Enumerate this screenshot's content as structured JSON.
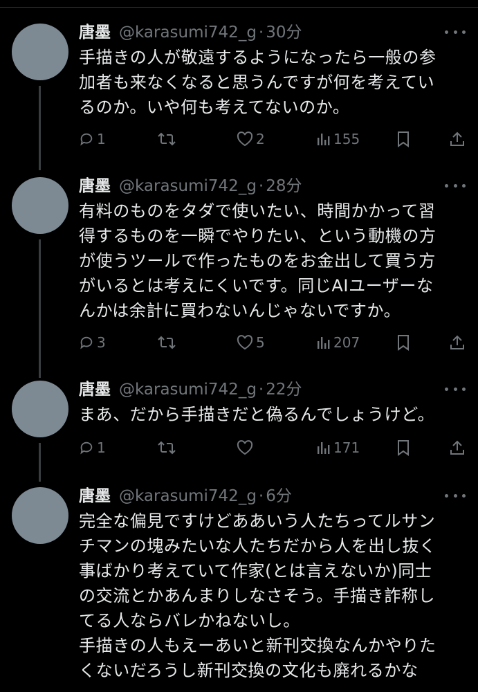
{
  "tweets": [
    {
      "name": "唐墨",
      "handle": "@karasumi742_g",
      "separator": "·",
      "time": "30分",
      "lines": [
        "手描きの人が敬遠するようになったら一般の参",
        "加者も来なくなると思うんですが何を考えてい",
        "るのか。いや何も考えてないのか。"
      ],
      "replies": "1",
      "retweets": "",
      "likes": "2",
      "views": "155"
    },
    {
      "name": "唐墨",
      "handle": "@karasumi742_g",
      "separator": "·",
      "time": "28分",
      "lines": [
        "有料のものをタダで使いたい、時間かかって習",
        "得するものを一瞬でやりたい、という動機の方",
        "が使うツールで作ったものをお金出して買う方",
        "がいるとは考えにくいです。同じAIユーザーな",
        "んかは余計に買わないんじゃないですか。"
      ],
      "replies": "3",
      "retweets": "",
      "likes": "5",
      "views": "207"
    },
    {
      "name": "唐墨",
      "handle": "@karasumi742_g",
      "separator": "·",
      "time": "22分",
      "lines": [
        "まあ、だから手描きだと偽るんでしょうけど。"
      ],
      "replies": "1",
      "retweets": "",
      "likes": "",
      "views": "171"
    },
    {
      "name": "唐墨",
      "handle": "@karasumi742_g",
      "separator": "·",
      "time": "6分",
      "lines": [
        "完全な偏見ですけどああいう人たちってルサン",
        "チマンの塊みたいな人たちだから人を出し抜く",
        "事ばかり考えていて作家(とは言えないか)同士",
        "の交流とかあんまりしなさそう。手描き詐称し",
        "てる人ならバレかねないし。",
        "手描きの人もえーあいと新刊交換なんかやりた",
        "くないだろうし新刊交換の文化も廃れるかな"
      ],
      "replies": "",
      "retweets": "",
      "likes": "",
      "views": ""
    }
  ],
  "icons": {
    "reply": "reply-icon",
    "retweet": "retweet-icon",
    "like": "like-icon",
    "views": "views-icon",
    "bookmark": "bookmark-icon",
    "share": "share-icon",
    "more": "more-icon"
  },
  "colors": {
    "background": "#000000",
    "text": "#e7e9ea",
    "secondary": "#71767b",
    "thread_line": "#3a3d40"
  }
}
